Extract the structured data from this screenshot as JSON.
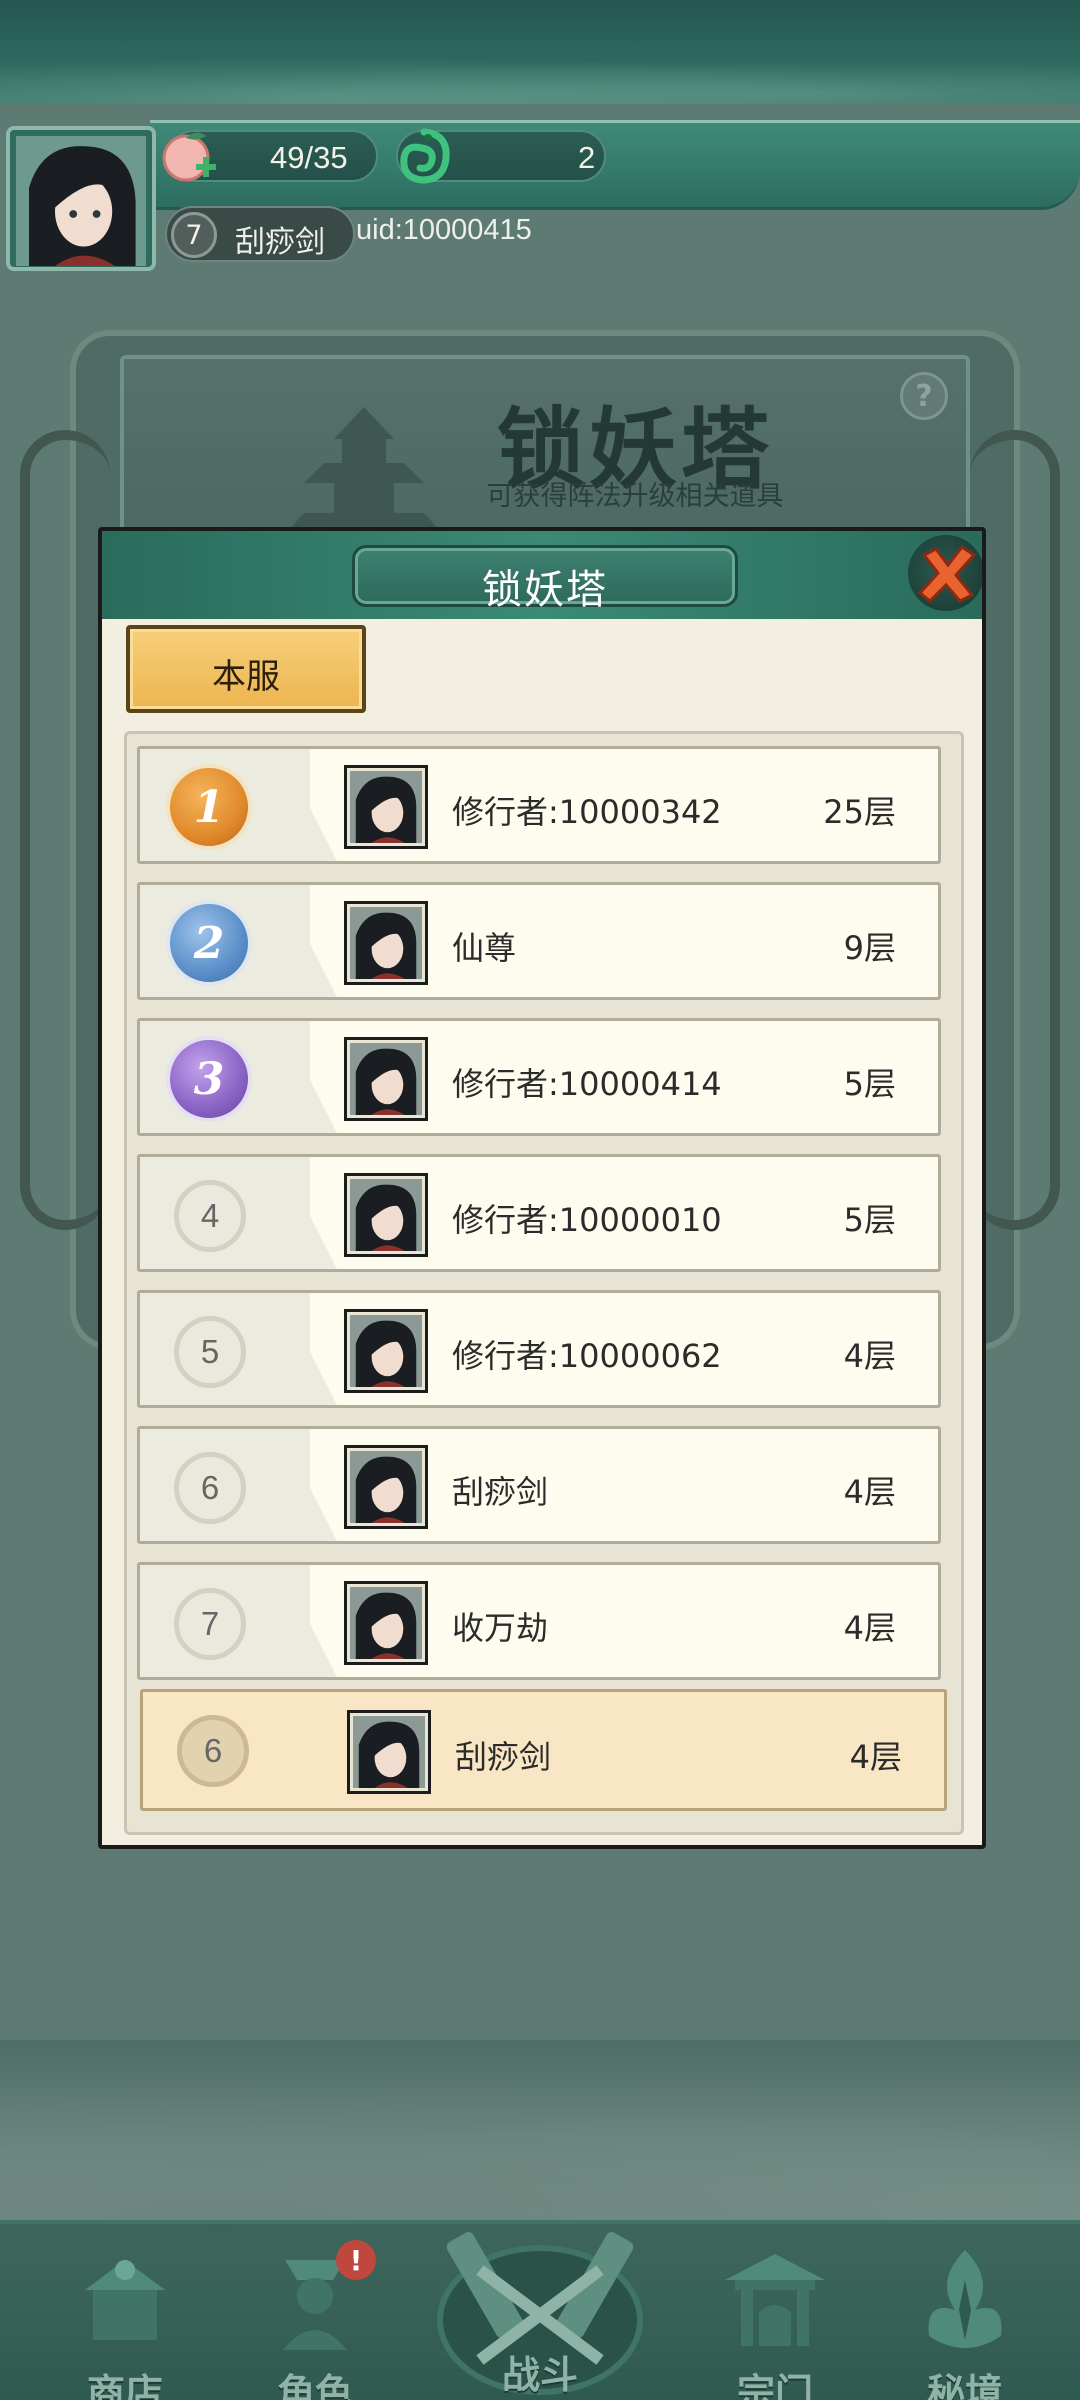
{
  "player": {
    "stamina": "49/35",
    "currency": "2",
    "level": "7",
    "name": "刮痧剑",
    "uid": "uid:10000415"
  },
  "banner": {
    "title": "锁妖塔",
    "subtitle": "可获得阵法升级相关道具"
  },
  "dialog": {
    "title": "锁妖塔",
    "tab_label": "本服"
  },
  "ranking": [
    {
      "rank": "1",
      "name": "修行者:10000342",
      "floor": "25层"
    },
    {
      "rank": "2",
      "name": "仙尊",
      "floor": "9层"
    },
    {
      "rank": "3",
      "name": "修行者:10000414",
      "floor": "5层"
    },
    {
      "rank": "4",
      "name": "修行者:10000010",
      "floor": "5层"
    },
    {
      "rank": "5",
      "name": "修行者:10000062",
      "floor": "4层"
    },
    {
      "rank": "6",
      "name": "刮痧剑",
      "floor": "4层"
    },
    {
      "rank": "7",
      "name": "收万劫",
      "floor": "4层"
    }
  ],
  "my_rank": {
    "rank": "6",
    "name": "刮痧剑",
    "floor": "4层"
  },
  "nav": {
    "shop": "商店",
    "character": "角色",
    "battle": "战斗",
    "sect": "宗门",
    "secret_realm": "秘境",
    "alert": "!"
  },
  "colors": {
    "rank1": "#e08a2c",
    "rank2": "#5b8fc9",
    "rank3": "#8a63c4",
    "accent_green": "#2e6a5c",
    "tab_gold": "#ecb54f"
  }
}
